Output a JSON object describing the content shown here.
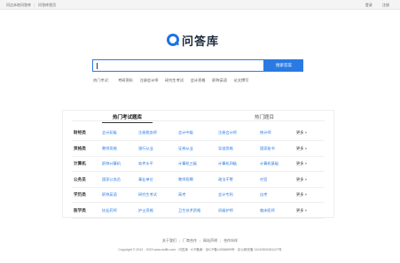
{
  "topbar": {
    "left_links": [
      "问达本地问答库",
      "问答库首页"
    ],
    "right_links": [
      "登录",
      "注册"
    ]
  },
  "logo": {
    "text": "问答库"
  },
  "search": {
    "placeholder": "",
    "button_label": "搜索答案"
  },
  "hot_search": {
    "lead": "热门考试:",
    "items": [
      "考研资料",
      "注册会计师",
      "研究生考试",
      "会计资格",
      "职称英语",
      "论文撰写"
    ]
  },
  "panel": {
    "tabs": [
      "热门考试题库",
      "热门题目"
    ],
    "more_label": "更多 »",
    "rows": [
      {
        "category": "财经类",
        "items": [
          "会计初级",
          "注册税务师",
          "会计中级",
          "注册会计师",
          "统计师"
        ]
      },
      {
        "category": "资格类",
        "items": [
          "教师资格",
          "银行从业",
          "证券从业",
          "导游资格",
          "国家秘书"
        ]
      },
      {
        "category": "计算机",
        "items": [
          "职称计算机",
          "软件水平",
          "计算机三级",
          "计算机四级",
          "计算机基础"
        ]
      },
      {
        "category": "公务员",
        "items": [
          "国家公务员",
          "事业单位",
          "教师招聘",
          "政法干警",
          "村官"
        ]
      },
      {
        "category": "学历类",
        "items": [
          "职称英语",
          "研究生考试",
          "高考",
          "会计专科",
          "自考"
        ]
      },
      {
        "category": "医学类",
        "items": [
          "执业药师",
          "护士资格",
          "卫生技术资格",
          "初级护师",
          "临床医师"
        ]
      }
    ]
  },
  "footer": {
    "links": [
      "关于我们",
      "厂商合作",
      "网站声明",
      "合作伙伴"
    ],
    "copyright": "Copyright © 2012 - 2023 www.wdlib.com · 问答库 · ICP备案 · 京ICP备14058899号 · 京公网安备 11010502051127号"
  }
}
